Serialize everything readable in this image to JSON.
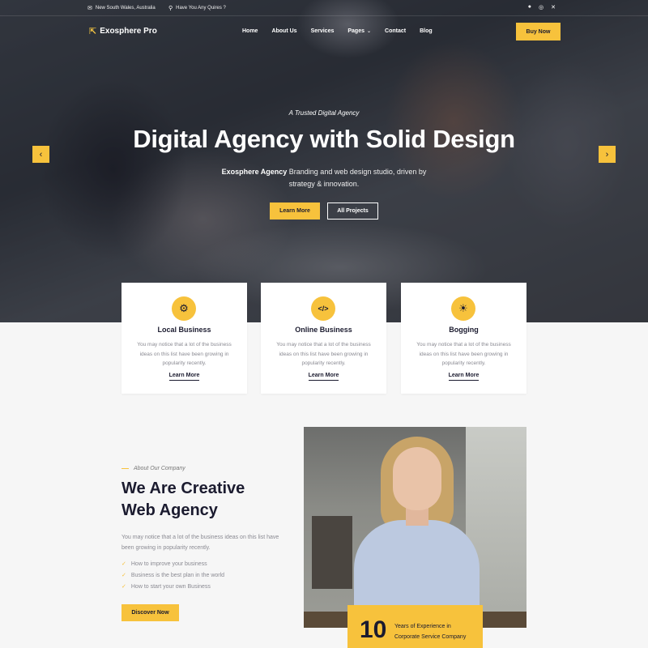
{
  "topbar": {
    "location": "New South Wales, Australia",
    "query": "Have You Any Quires ?"
  },
  "brand": {
    "name": "Exosphere Pro"
  },
  "nav": {
    "items": [
      "Home",
      "About Us",
      "Services",
      "Pages",
      "Contact",
      "Blog"
    ],
    "buy_label": "Buy Now"
  },
  "hero": {
    "tagline": "A Trusted Digital Agency",
    "headline": "Digital Agency with Solid Design",
    "sub_strong": "Exosphere Agency",
    "sub_rest": " Branding and web design studio, driven by",
    "sub_line2": "strategy & innovation.",
    "btn_primary": "Learn More",
    "btn_outline": "All Projects"
  },
  "cards": [
    {
      "title": "Local Business",
      "icon": "gear-icon",
      "desc": "You may notice that a lot of the business ideas on this list have been growing in popularity recently.",
      "link": "Learn More"
    },
    {
      "title": "Online Business",
      "icon": "code-icon",
      "desc": "You may notice that a lot of the business ideas on this list have been growing in popularity recently.",
      "link": "Learn More"
    },
    {
      "title": "Bogging",
      "icon": "lightbulb-icon",
      "desc": "You may notice that a lot of the business ideas on this list have been growing in popularity recently.",
      "link": "Learn More"
    }
  ],
  "about": {
    "label": "About Our Company",
    "title_line1": "We Are Creative",
    "title_line2": "Web Agency",
    "text": "You may notice that a lot of the business ideas on this list have been growing in popularity recently.",
    "checks": [
      "How to improve your business",
      "Business is the best plan in the world",
      "How to start your own Business"
    ],
    "button": "Discover Now"
  },
  "experience": {
    "number": "10",
    "line1": "Years of Experience in",
    "line2": "Corporate Service Company"
  },
  "colors": {
    "accent": "#f7c23c",
    "dark": "#1b1b2f"
  }
}
